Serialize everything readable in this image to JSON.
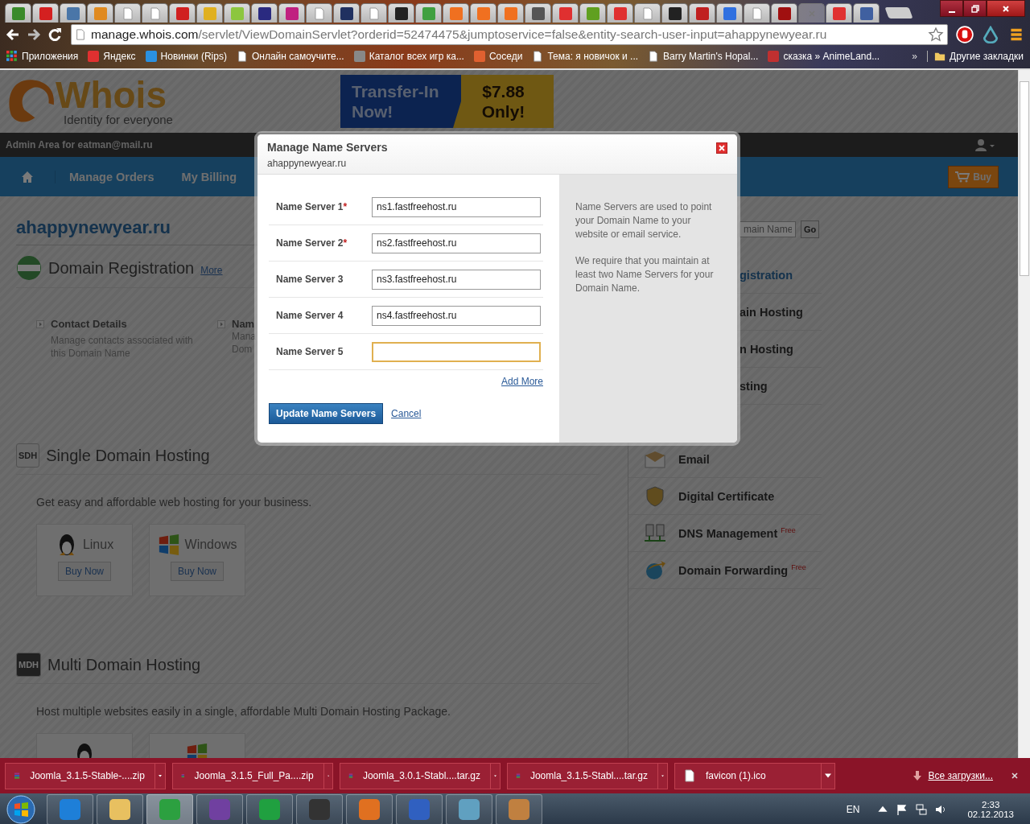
{
  "browser": {
    "tabs": [
      {
        "kind": "site",
        "color": "#3a8a2a",
        "selected": false
      },
      {
        "kind": "site",
        "color": "#d42020",
        "selected": false
      },
      {
        "kind": "site",
        "color": "#4a76a8",
        "selected": false
      },
      {
        "kind": "site",
        "color": "#e08a20",
        "selected": false
      },
      {
        "kind": "page",
        "selected": false
      },
      {
        "kind": "page",
        "selected": false
      },
      {
        "kind": "site",
        "color": "#d02020",
        "selected": false
      },
      {
        "kind": "site",
        "color": "#e0b020",
        "selected": false
      },
      {
        "kind": "site",
        "color": "#8cc63f",
        "selected": false
      },
      {
        "kind": "site",
        "color": "#2a2a80",
        "selected": false
      },
      {
        "kind": "site",
        "color": "#c02080",
        "selected": false
      },
      {
        "kind": "page",
        "selected": false
      },
      {
        "kind": "site",
        "color": "#203060",
        "selected": false
      },
      {
        "kind": "page",
        "selected": false
      },
      {
        "kind": "site",
        "color": "#222222",
        "selected": false
      },
      {
        "kind": "site",
        "color": "#40a040",
        "selected": false
      },
      {
        "kind": "site",
        "color": "#f07020",
        "selected": false
      },
      {
        "kind": "site",
        "color": "#f07020",
        "selected": false
      },
      {
        "kind": "site",
        "color": "#f07020",
        "selected": false
      },
      {
        "kind": "site",
        "color": "#555555",
        "selected": false
      },
      {
        "kind": "site",
        "color": "#e03030",
        "selected": false
      },
      {
        "kind": "site",
        "color": "#60a020",
        "selected": false
      },
      {
        "kind": "site",
        "color": "#e03030",
        "selected": false
      },
      {
        "kind": "page",
        "selected": false
      },
      {
        "kind": "site",
        "color": "#222222",
        "selected": false
      },
      {
        "kind": "site",
        "color": "#c02020",
        "selected": false
      },
      {
        "kind": "site",
        "color": "#3070e0",
        "selected": false
      },
      {
        "kind": "page",
        "selected": false
      },
      {
        "kind": "site",
        "color": "#a01010",
        "selected": false
      },
      {
        "selected": true
      },
      {
        "kind": "site",
        "color": "#e03030",
        "selected": false
      },
      {
        "kind": "site",
        "color": "#4060a0",
        "selected": false
      }
    ],
    "url_host": "manage.whois.com",
    "url_path": "/servlet/ViewDomainServlet?orderid=52474475&jumptoservice=false&entity-search-user-input=ahappynewyear.ru",
    "bookmarks": [
      {
        "kind": "apps",
        "label": "Приложения"
      },
      {
        "kind": "site",
        "color": "#e03030",
        "label": "Яндекс"
      },
      {
        "kind": "site",
        "color": "#2a90e0",
        "label": "Новинки (Rips)"
      },
      {
        "kind": "page",
        "label": "Онлайн самоучите..."
      },
      {
        "kind": "site",
        "color": "#888888",
        "label": "Каталог всех игр ка..."
      },
      {
        "kind": "site",
        "color": "#e06030",
        "label": "Соседи"
      },
      {
        "kind": "page",
        "label": "Тема: я новичок и ..."
      },
      {
        "kind": "page",
        "label": "Barry Martin's Hopal..."
      },
      {
        "kind": "site",
        "color": "#c03030",
        "label": "сказка » AnimeLand..."
      }
    ],
    "bookmarks_more": "»",
    "other_bookmarks": "Другие закладки"
  },
  "page": {
    "logo": "Whois",
    "tagline": "Identity for everyone",
    "banner_text": "Transfer-In Now!",
    "banner_price": "$7.88 Only!",
    "admin": "Admin Area for eatman@mail.ru",
    "nav": [
      "Manage Orders",
      "My Billing"
    ],
    "buy": "Buy",
    "domain": "ahappynewyear.ru",
    "registration": {
      "title": "Domain Registration",
      "more": "More",
      "links": [
        {
          "title": "Contact Details",
          "lines": [
            "Manage contacts associated with",
            "this Domain Name"
          ]
        },
        {
          "title": "Nam",
          "lines": [
            "Mana",
            "Dom"
          ]
        }
      ]
    },
    "sections": [
      {
        "badge": "SDH",
        "badge_dark": false,
        "title": "Single Domain Hosting",
        "desc": "Get easy and affordable web hosting for your business.",
        "plans": [
          {
            "kind": "linux",
            "name": "Linux",
            "button": "Buy Now"
          },
          {
            "kind": "windows",
            "name": "Windows",
            "button": "Buy Now"
          }
        ]
      },
      {
        "badge": "MDH",
        "badge_dark": true,
        "title": "Multi Domain Hosting",
        "desc": "Host multiple websites easily in a single, affordable Multi Domain Hosting Package.",
        "plans": [
          {
            "kind": "linux"
          },
          {
            "kind": "windows"
          }
        ]
      }
    ],
    "search": {
      "placeholder": "main Name",
      "go": "Go"
    },
    "products": [
      {
        "label": "gistration",
        "covered": true,
        "selected": true
      },
      {
        "label": "ain Hosting",
        "covered": true,
        "selected": false
      },
      {
        "label": "n Hosting",
        "covered": true,
        "selected": false
      },
      {
        "label": "sting",
        "covered": true,
        "selected": false
      },
      {
        "label": "Email",
        "covered": false,
        "selected": false,
        "kind": "email"
      },
      {
        "label": "Digital Certificate",
        "covered": false,
        "selected": false,
        "kind": "certificate"
      },
      {
        "label": "DNS Management",
        "covered": false,
        "selected": false,
        "kind": "dns",
        "tag": "Free"
      },
      {
        "label": "Domain Forwarding",
        "covered": false,
        "selected": false,
        "kind": "forwarding",
        "tag": "Free"
      }
    ]
  },
  "modal": {
    "title": "Manage Name Servers",
    "subtitle": "ahappynewyear.ru",
    "required_mark": "*",
    "fields": [
      {
        "label": "Name Server 1",
        "required": true,
        "value": "ns1.fastfreehost.ru",
        "focused": false
      },
      {
        "label": "Name Server 2",
        "required": true,
        "value": "ns2.fastfreehost.ru",
        "focused": false
      },
      {
        "label": "Name Server 3",
        "required": false,
        "value": "ns3.fastfreehost.ru",
        "focused": false
      },
      {
        "label": "Name Server 4",
        "required": false,
        "value": "ns4.fastfreehost.ru",
        "focused": false
      },
      {
        "label": "Name Server 5",
        "required": false,
        "focused": true
      }
    ],
    "add_more": "Add More",
    "submit": "Update Name Servers",
    "cancel": "Cancel",
    "help": [
      "Name Servers are used to point your Domain Name to your website or email service.",
      "We require that you maintain at least two Name Servers for your Domain Name."
    ]
  },
  "downloads": {
    "items": [
      {
        "kind": "archive",
        "name": "Joomla_3.1.5-Stable-....zip"
      },
      {
        "kind": "archive",
        "name": "Joomla_3.1.5_Full_Pa....zip"
      },
      {
        "kind": "archive",
        "name": "Joomla_3.0.1-Stabl....tar.gz"
      },
      {
        "kind": "archive",
        "name": "Joomla_3.1.5-Stabl....tar.gz"
      },
      {
        "kind": "file",
        "name": "favicon (1).ico"
      }
    ],
    "all": "Все загрузки..."
  },
  "taskbar": {
    "apps": [
      {
        "color": "#1e7fd8",
        "selected": false
      },
      {
        "color": "#e8c060",
        "selected": false
      },
      {
        "color": "#2ca040",
        "selected": true
      },
      {
        "color": "#7040a0",
        "selected": false
      },
      {
        "color": "#20a040",
        "selected": false
      },
      {
        "color": "#333333",
        "selected": false
      },
      {
        "color": "#e07020",
        "selected": false
      },
      {
        "color": "#3060c0",
        "selected": false
      },
      {
        "color": "#60a0c0",
        "selected": false
      },
      {
        "color": "#c08040",
        "selected": false
      }
    ],
    "lang": "EN",
    "time": "2:33",
    "date": "02.12.2013"
  }
}
